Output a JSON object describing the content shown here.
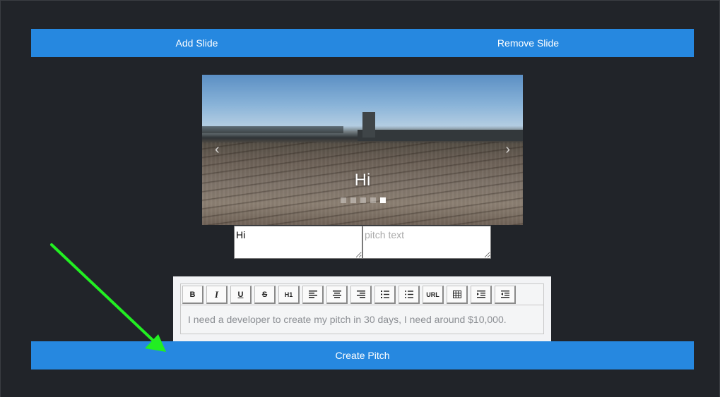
{
  "slide_actions": {
    "add_label": "Add Slide",
    "remove_label": "Remove Slide"
  },
  "carousel": {
    "caption": "Hi",
    "prev_glyph": "‹",
    "next_glyph": "›",
    "indicator_count": 5,
    "active_indicator": 5
  },
  "slide_fields": {
    "title_value": "Hi",
    "text_placeholder": "pitch text"
  },
  "editor": {
    "toolbar": [
      {
        "name": "bold-button",
        "label": "B",
        "icon": "bold-icon"
      },
      {
        "name": "italic-button",
        "label": "I",
        "icon": "italic-icon"
      },
      {
        "name": "underline-button",
        "label": "U",
        "icon": "underline-icon"
      },
      {
        "name": "strikethrough-button",
        "label": "S",
        "icon": "strikethrough-icon"
      },
      {
        "name": "heading-button",
        "label": "H1",
        "icon": "heading-icon"
      },
      {
        "name": "align-left-button",
        "label": "",
        "icon": "align-left-icon"
      },
      {
        "name": "align-center-button",
        "label": "",
        "icon": "align-center-icon"
      },
      {
        "name": "align-right-button",
        "label": "",
        "icon": "align-right-icon"
      },
      {
        "name": "ordered-list-button",
        "label": "",
        "icon": "ordered-list-icon"
      },
      {
        "name": "unordered-list-button",
        "label": "",
        "icon": "unordered-list-icon"
      },
      {
        "name": "link-button",
        "label": "URL",
        "icon": "link-icon"
      },
      {
        "name": "table-button",
        "label": "",
        "icon": "table-icon"
      },
      {
        "name": "indent-button",
        "label": "",
        "icon": "indent-icon"
      },
      {
        "name": "outdent-button",
        "label": "",
        "icon": "outdent-icon"
      }
    ],
    "placeholder": "I need a developer to create my pitch in 30 days, I need around $10,000."
  },
  "create_pitch_label": "Create Pitch",
  "colors": {
    "background": "#212429",
    "primary_button": "#2688e0",
    "annotation_arrow": "#22ee22"
  }
}
